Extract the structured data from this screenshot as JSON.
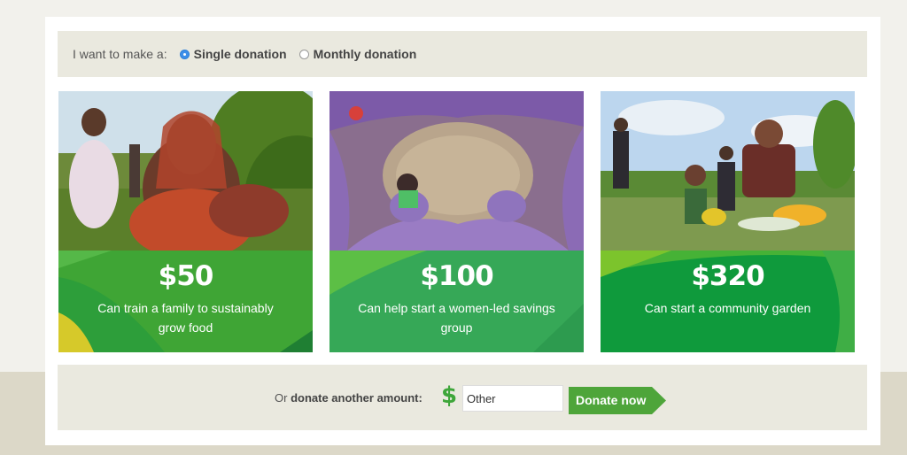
{
  "donation_type": {
    "lead": "I want to make a:",
    "options": [
      {
        "label": "Single donation",
        "checked": true
      },
      {
        "label": "Monthly donation",
        "checked": false
      }
    ]
  },
  "tiles": [
    {
      "amount": "$50",
      "description": "Can train a family to sustainably grow food"
    },
    {
      "amount": "$100",
      "description": "Can help start a women-led savings group"
    },
    {
      "amount": "$320",
      "description": "Can start a community garden"
    }
  ],
  "other": {
    "label_prefix": "Or ",
    "label_bold": "donate another amount:",
    "currency_symbol": "$",
    "input_value": "Other",
    "button_label": "Donate now"
  },
  "colors": {
    "green_primary": "#3fa535",
    "green_dark": "#0f9a3c",
    "accent_yellow": "#d6c92a"
  }
}
